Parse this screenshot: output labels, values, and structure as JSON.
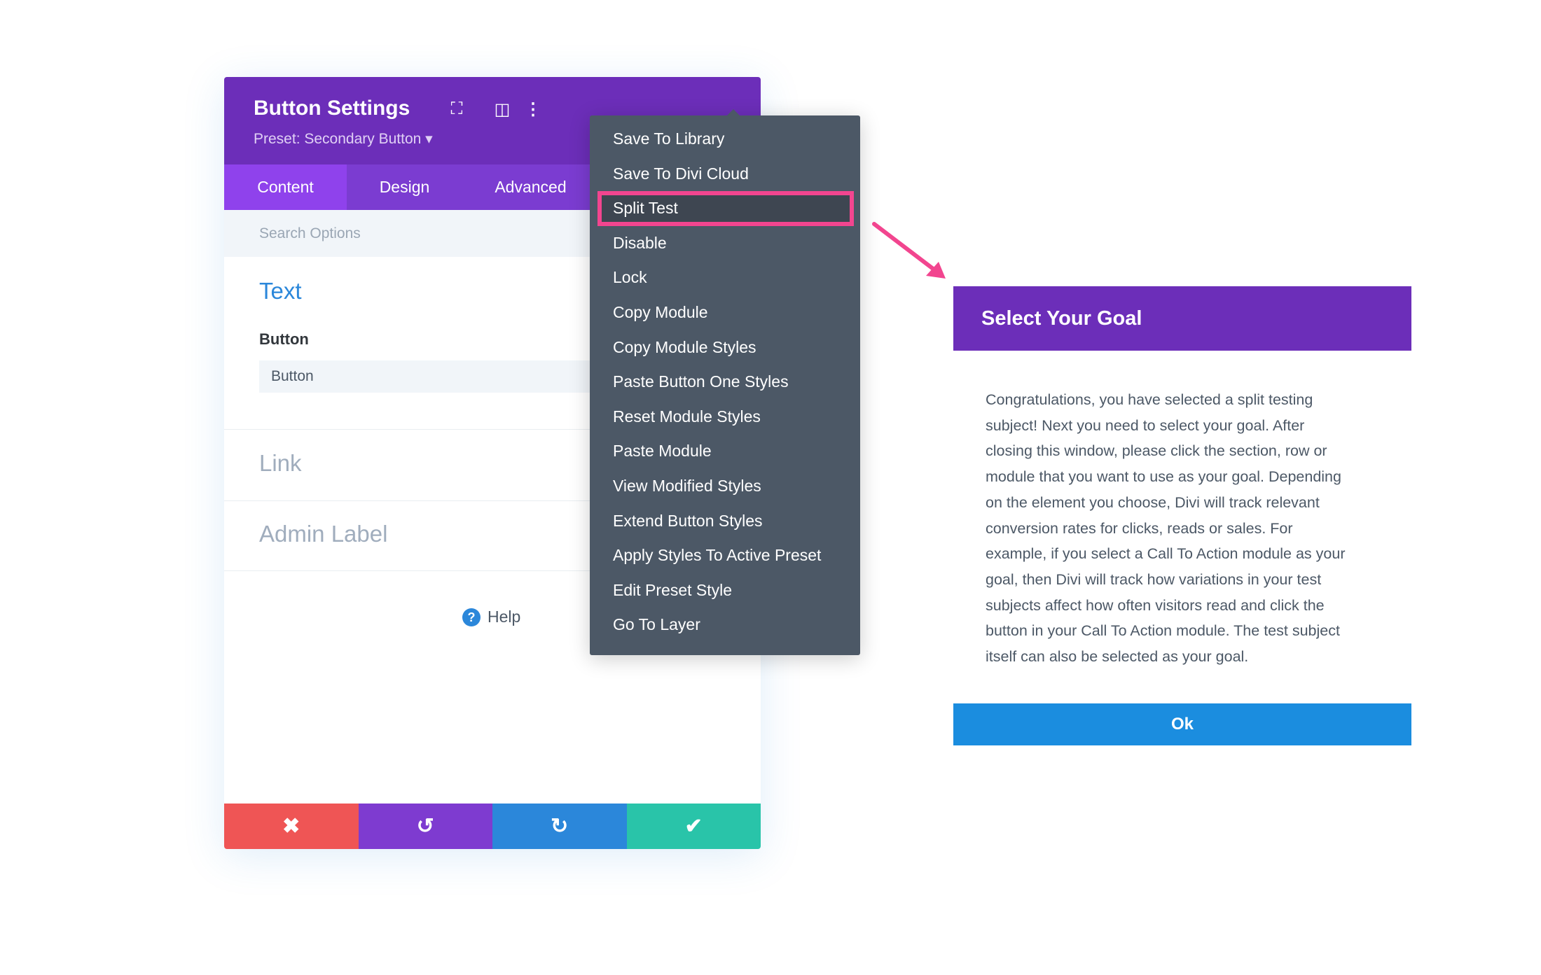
{
  "settings": {
    "title": "Button Settings",
    "preset": "Preset: Secondary Button ▾",
    "tabs": [
      "Content",
      "Design",
      "Advanced"
    ],
    "search_placeholder": "Search Options",
    "sections": {
      "text": "Text",
      "link": "Link",
      "admin": "Admin Label"
    },
    "button_label": "Button",
    "button_value": "Button",
    "help": "Help"
  },
  "menu": {
    "items": [
      "Save To Library",
      "Save To Divi Cloud",
      "Split Test",
      "Disable",
      "Lock",
      "Copy Module",
      "Copy Module Styles",
      "Paste Button One Styles",
      "Reset Module Styles",
      "Paste Module",
      "View Modified Styles",
      "Extend Button Styles",
      "Apply Styles To Active Preset",
      "Edit Preset Style",
      "Go To Layer"
    ],
    "highlighted": "Split Test",
    "highlight_color": "#f2458f"
  },
  "goal": {
    "title": "Select Your Goal",
    "lines": [
      "Congratulations, you have selected a split testing",
      "subject! Next you need to select your goal. After",
      "closing this window, please click the section, row or",
      "module that you want to use as your goal. Depending",
      "on the element you choose, Divi will track relevant",
      "conversion rates for clicks, reads or sales. For",
      "example, if you select a Call To Action module as your",
      "goal, then Divi will track how variations in your test",
      "subjects affect how often visitors read and click the",
      "button in your Call To Action module. The test subject",
      "itself can also be selected as your goal."
    ],
    "ok": "Ok"
  },
  "colors": {
    "purple": "#6c2eb9",
    "cancel": "#ef5555",
    "undo": "#7e3bd0",
    "redo": "#2b87da",
    "save": "#29c4a9"
  }
}
